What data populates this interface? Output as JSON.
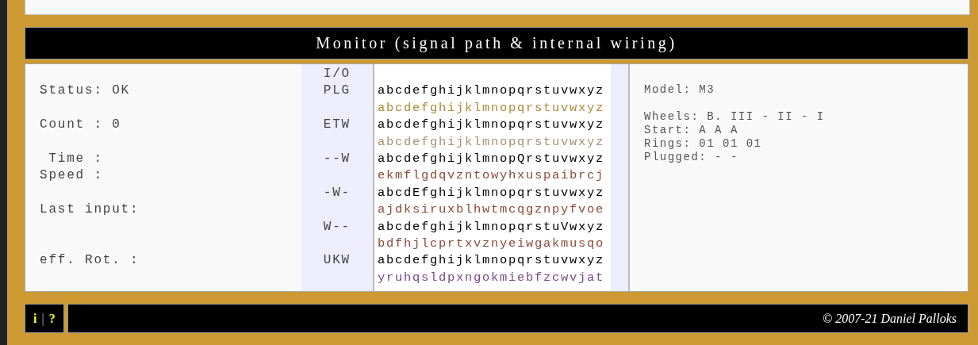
{
  "title": "Monitor (signal path & internal wiring)",
  "rows": [
    {
      "io": "I/O"
    },
    {
      "io": "PLG",
      "letters": "abcdefghijklmnopqrstuvwxyz",
      "color": "#000000",
      "info": "Status: OK"
    },
    {
      "letters": "abcdefghijklmnopqrstuvwxyz",
      "color": "#a88a3a"
    },
    {
      "io": "ETW",
      "letters": "abcdefghijklmnopqrstuvwxyz",
      "color": "#000000",
      "info": "Count : 0"
    },
    {
      "letters": "abcdefghijklmnopqrstuvwxyz",
      "color": "#a89070"
    },
    {
      "io": "--W",
      "letters": "abcdefghijklmnopQrstuvwxyz",
      "color": "#000000",
      "info": " Time :"
    },
    {
      "letters": "ekmflgdqvzntowyhxuspaibrcj",
      "color": "#8a4a3a",
      "info": "Speed :"
    },
    {
      "io": "-W-",
      "letters": "abcdEfghijklmnopqrstuvwxyz",
      "color": "#000000"
    },
    {
      "letters": "ajdksiruxblhwtmcqgznpyfvoe",
      "color": "#8a4a3a",
      "info": "Last input:"
    },
    {
      "io": "W--",
      "letters": "abcdefghijklmnopqrstuVwxyz",
      "color": "#000000"
    },
    {
      "letters": "bdfhjlcprtxvznyeiwgakmusqo",
      "color": "#8a4a3a"
    },
    {
      "io": "UKW",
      "letters": "abcdefghijklmnopqrstuvwxyz",
      "color": "#000000",
      "info": "eff. Rot. :"
    },
    {
      "letters": "yruhqsldpxngokmiebfzcwvjat",
      "color": "#7a4a8a"
    }
  ],
  "model": "Model: M3",
  "settings": [
    "Wheels: B. III - II - I",
    "Start: A A A",
    "Rings: 01 01 01",
    "Plugged: - -"
  ],
  "footer": {
    "links": [
      "i",
      "?"
    ],
    "separator": "|",
    "copyright": "© 2007-21 Daniel Palloks"
  }
}
